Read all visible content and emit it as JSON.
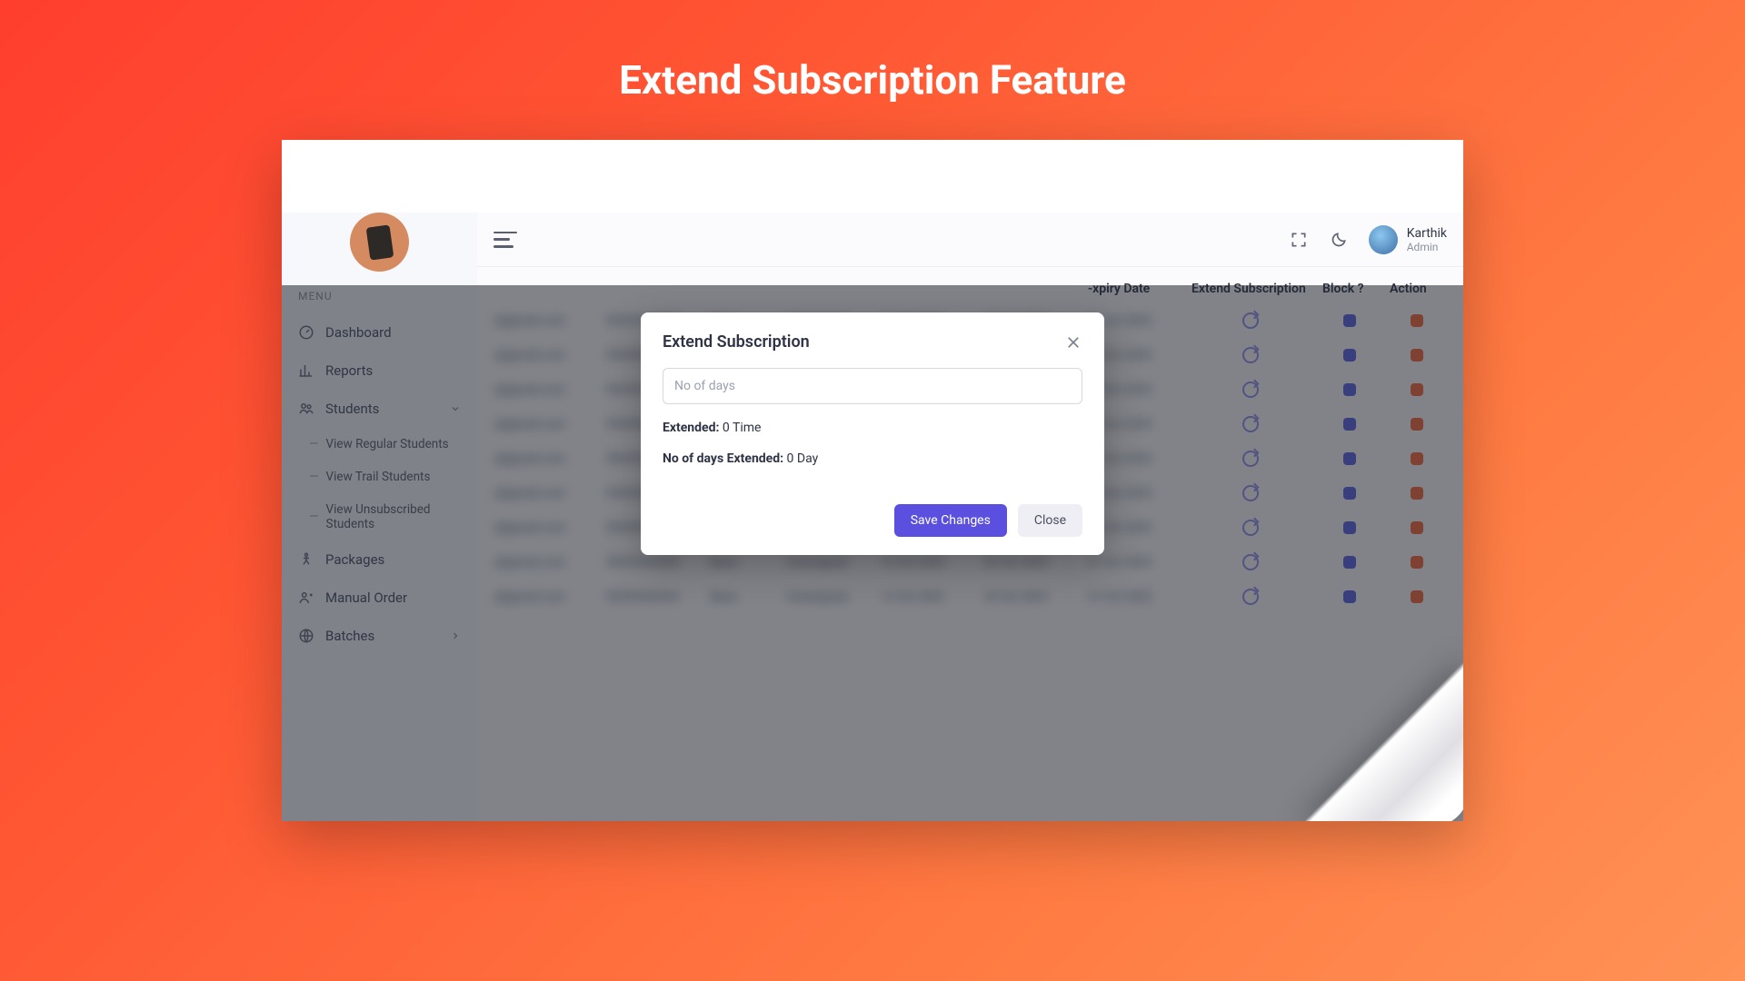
{
  "page_title": "Extend Subscription Feature",
  "sidebar": {
    "title": "MENU",
    "items": [
      {
        "label": "Dashboard",
        "has_sub": false
      },
      {
        "label": "Reports",
        "has_sub": false
      },
      {
        "label": "Students",
        "has_sub": true,
        "expanded": true,
        "sub": [
          {
            "label": "View Regular Students"
          },
          {
            "label": "View Trail Students"
          },
          {
            "label": "View Unsubscribed Students"
          }
        ]
      },
      {
        "label": "Packages",
        "has_sub": false
      },
      {
        "label": "Manual Order",
        "has_sub": false
      },
      {
        "label": "Batches",
        "has_sub": true,
        "expanded": false
      }
    ]
  },
  "header": {
    "user_name": "Karthik",
    "user_role": "Admin"
  },
  "table": {
    "columns": [
      "-xpiry Date",
      "Extend Subscription",
      "Block ?",
      "Action"
    ],
    "col_expiry": "-xpiry Date",
    "col_extend": "Extend Subscription",
    "col_block": "Block ?",
    "col_action": "Action"
  },
  "modal": {
    "title": "Extend Subscription",
    "placeholder": "No of days",
    "extended_label": "Extended:",
    "extended_value": "0 Time",
    "days_label": "No of days Extended:",
    "days_value": "0 Day",
    "save_label": "Save Changes",
    "close_label": "Close"
  },
  "colors": {
    "primary": "#5b4fdf",
    "bg_gradient_start": "#ff3e2e",
    "bg_gradient_end": "#ff9256"
  }
}
